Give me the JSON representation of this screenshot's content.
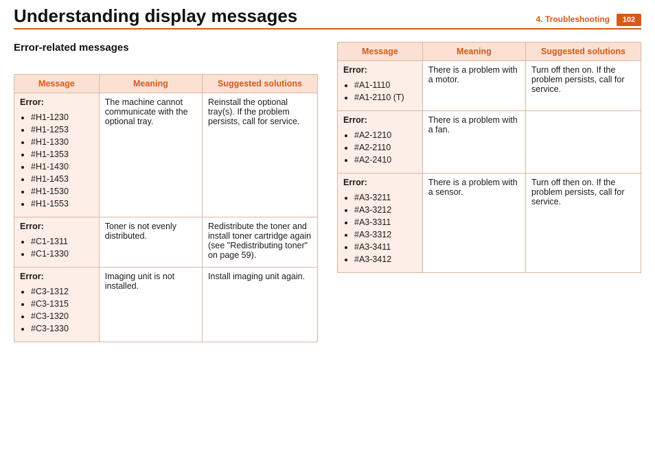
{
  "title": "Understanding display messages",
  "breadcrumb": "4.  Troubleshooting",
  "page_number": "102",
  "section_heading": "Error-related messages",
  "headers": {
    "message": "Message",
    "meaning": "Meaning",
    "solutions": "Suggested solutions"
  },
  "error_label": "Error:",
  "left_table": [
    {
      "codes": [
        "#H1-1230",
        "#H1-1253",
        "#H1-1330",
        "#H1-1353",
        "#H1-1430",
        "#H1-1453",
        "#H1-1530",
        "#H1-1553"
      ],
      "meaning": "The machine cannot communicate with the optional tray.",
      "solution": "Reinstall the optional tray(s). If the problem persists, call for service."
    },
    {
      "codes": [
        "#C1-1311",
        "#C1-1330"
      ],
      "meaning": "Toner is not evenly distributed.",
      "solution": "Redistribute the toner and install toner cartridge again (see \"Redistributing toner\" on page 59)."
    },
    {
      "codes": [
        "#C3-1312",
        "#C3-1315",
        "#C3-1320",
        "#C3-1330"
      ],
      "meaning": "Imaging unit is not installed.",
      "solution": "Install imaging unit again."
    }
  ],
  "right_table": [
    {
      "codes": [
        "#A1-1110",
        "#A1-2110 (T)"
      ],
      "meaning": "There is a problem with a motor.",
      "solution": "Turn off then on. If the problem persists, call for service."
    },
    {
      "codes": [
        "#A2-1210",
        "#A2-2110",
        "#A2-2410"
      ],
      "meaning": "There is a problem with a fan.",
      "solution": ""
    },
    {
      "codes": [
        "#A3-3211",
        "#A3-3212",
        "#A3-3311",
        "#A3-3312",
        "#A3-3411",
        "#A3-3412"
      ],
      "meaning": "There is a problem with a sensor.",
      "solution": "Turn off then on. If the problem persists, call for service."
    }
  ]
}
